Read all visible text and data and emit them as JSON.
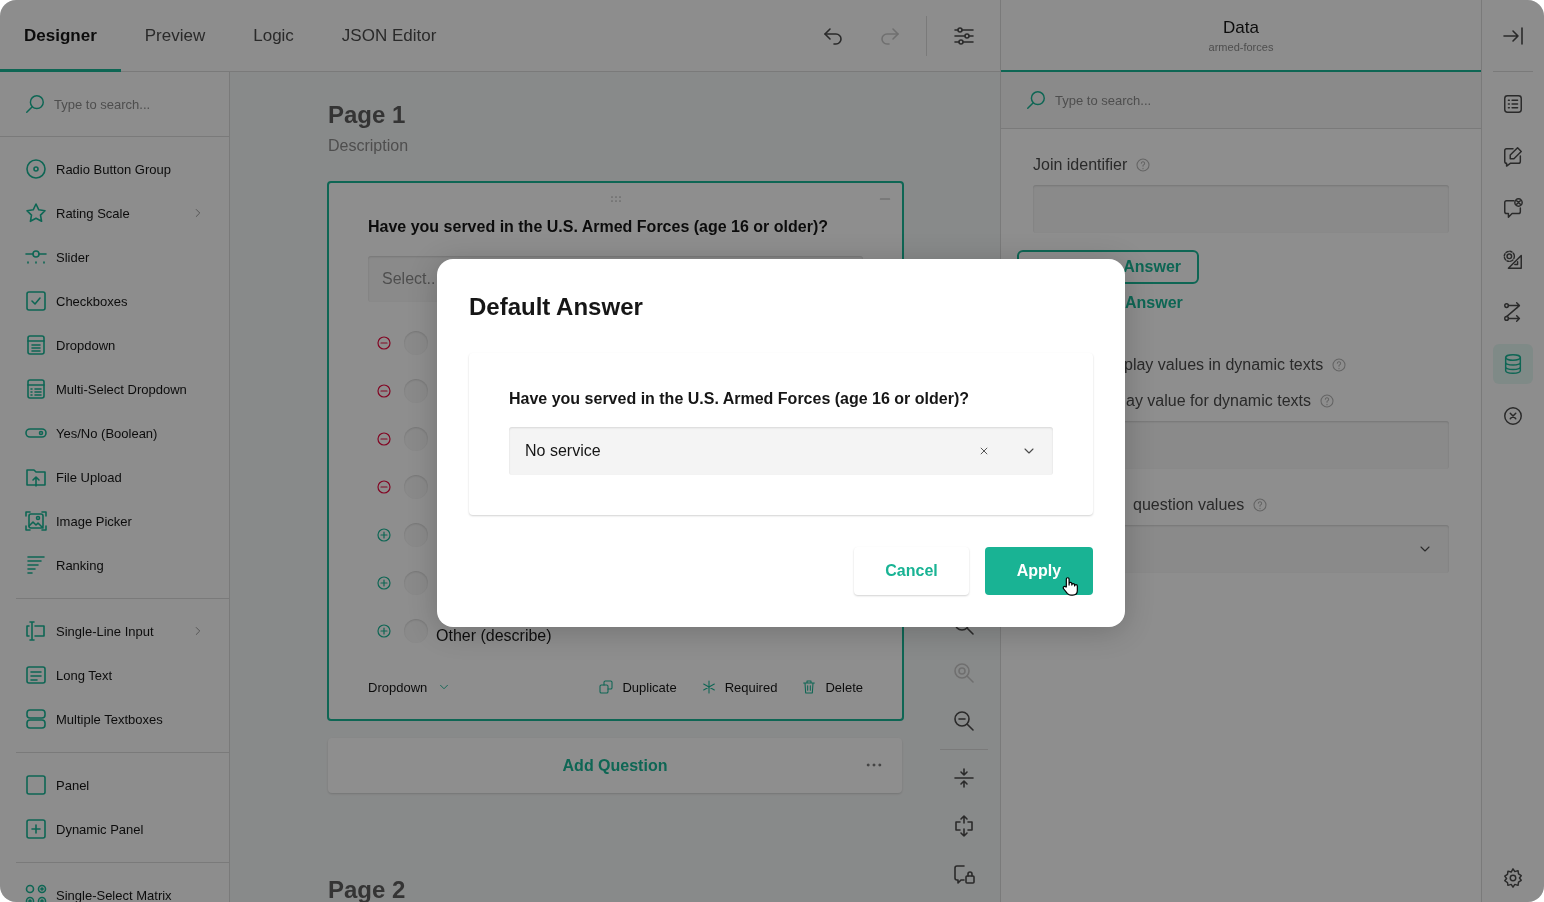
{
  "designer_tabs": [
    {
      "label": "Designer",
      "selected": true
    },
    {
      "label": "Preview",
      "selected": false
    },
    {
      "label": "Logic",
      "selected": false
    },
    {
      "label": "JSON Editor",
      "selected": false
    }
  ],
  "toolbar_buttons": [
    {
      "kind": "undo",
      "disabled": false
    },
    {
      "kind": "redo",
      "disabled": true
    },
    {
      "kind": "settings",
      "disabled": false
    }
  ],
  "toolbox": {
    "search_placeholder": "Type to search...",
    "groups": [
      {
        "items": [
          {
            "kind": "radio",
            "label": "Radio Button Group",
            "has_submenu": false
          },
          {
            "kind": "rating",
            "label": "Rating Scale",
            "has_submenu": true
          },
          {
            "kind": "slider",
            "label": "Slider",
            "has_submenu": false
          },
          {
            "kind": "checkbox",
            "label": "Checkboxes",
            "has_submenu": false
          },
          {
            "kind": "dropdown",
            "label": "Dropdown",
            "has_submenu": false
          },
          {
            "kind": "multiselect",
            "label": "Multi-Select Dropdown",
            "has_submenu": false
          },
          {
            "kind": "boolean",
            "label": "Yes/No (Boolean)",
            "has_submenu": false
          },
          {
            "kind": "file",
            "label": "File Upload",
            "has_submenu": false
          },
          {
            "kind": "image",
            "label": "Image Picker",
            "has_submenu": false
          },
          {
            "kind": "ranking",
            "label": "Ranking",
            "has_submenu": false
          }
        ]
      },
      {
        "items": [
          {
            "kind": "text",
            "label": "Single-Line Input",
            "has_submenu": true
          },
          {
            "kind": "comment",
            "label": "Long Text",
            "has_submenu": false
          },
          {
            "kind": "multitext",
            "label": "Multiple Textboxes",
            "has_submenu": false
          }
        ]
      },
      {
        "items": [
          {
            "kind": "panel",
            "label": "Panel",
            "has_submenu": false
          },
          {
            "kind": "dynpanel",
            "label": "Dynamic Panel",
            "has_submenu": false
          }
        ]
      },
      {
        "items": [
          {
            "kind": "matrix",
            "label": "Single-Select Matrix",
            "has_submenu": false
          }
        ]
      }
    ]
  },
  "page_1": {
    "title": "Page 1",
    "description": "Description",
    "question": {
      "title": "Have you served in the U.S. Armed Forces (age 16 or older)?",
      "placeholder": "Select..",
      "choices": [
        {
          "kind": "remove"
        },
        {
          "kind": "remove"
        },
        {
          "kind": "remove"
        },
        {
          "kind": "remove"
        },
        {
          "kind": "add"
        },
        {
          "kind": "add"
        },
        {
          "kind": "add",
          "label": "Other (describe)"
        }
      ],
      "type_label": "Dropdown",
      "actions": [
        {
          "kind": "duplicate",
          "label": "Duplicate"
        },
        {
          "kind": "required",
          "label": "Required"
        },
        {
          "kind": "delete",
          "label": "Delete"
        }
      ]
    },
    "add_question": "Add Question"
  },
  "page_2": {
    "title": "Page 2"
  },
  "zoom_tools": [
    {
      "kind": "zoom-in",
      "disabled": false
    },
    {
      "kind": "zoom-reset",
      "disabled": true
    },
    {
      "kind": "zoom-out",
      "disabled": false
    },
    {
      "kind": "divider"
    },
    {
      "kind": "collapse",
      "disabled": false
    },
    {
      "kind": "move",
      "disabled": false
    },
    {
      "kind": "lock",
      "disabled": false
    }
  ],
  "property_panel": {
    "title": "Data",
    "subtitle": "armed-forces",
    "search_placeholder": "Type to search...",
    "fields": [
      {
        "kind": "input",
        "label": "Join identifier",
        "help": true
      },
      {
        "kind": "button",
        "label": "Answer"
      },
      {
        "kind": "link",
        "label": "Answer"
      },
      {
        "kind": "checkbox",
        "label": "play values in dynamic texts",
        "help": true
      },
      {
        "kind": "input",
        "label": "ay value for dynamic texts",
        "help": true
      },
      {
        "kind": "dropdown",
        "label": "question values",
        "help": true
      }
    ]
  },
  "side_tabs": [
    {
      "kind": "list",
      "selected": false
    },
    {
      "kind": "edit",
      "selected": false
    },
    {
      "kind": "chat-x",
      "selected": false
    },
    {
      "kind": "gear-triangle",
      "selected": false
    },
    {
      "kind": "route",
      "selected": false
    },
    {
      "kind": "database",
      "selected": true
    },
    {
      "kind": "x-circle",
      "selected": false
    }
  ],
  "dialog": {
    "title": "Default Answer",
    "question": "Have you served in the U.S. Armed Forces (age 16 or older)?",
    "value": "No service",
    "buttons": [
      {
        "kind": "secondary",
        "label": "Cancel"
      },
      {
        "kind": "primary",
        "label": "Apply"
      }
    ]
  }
}
